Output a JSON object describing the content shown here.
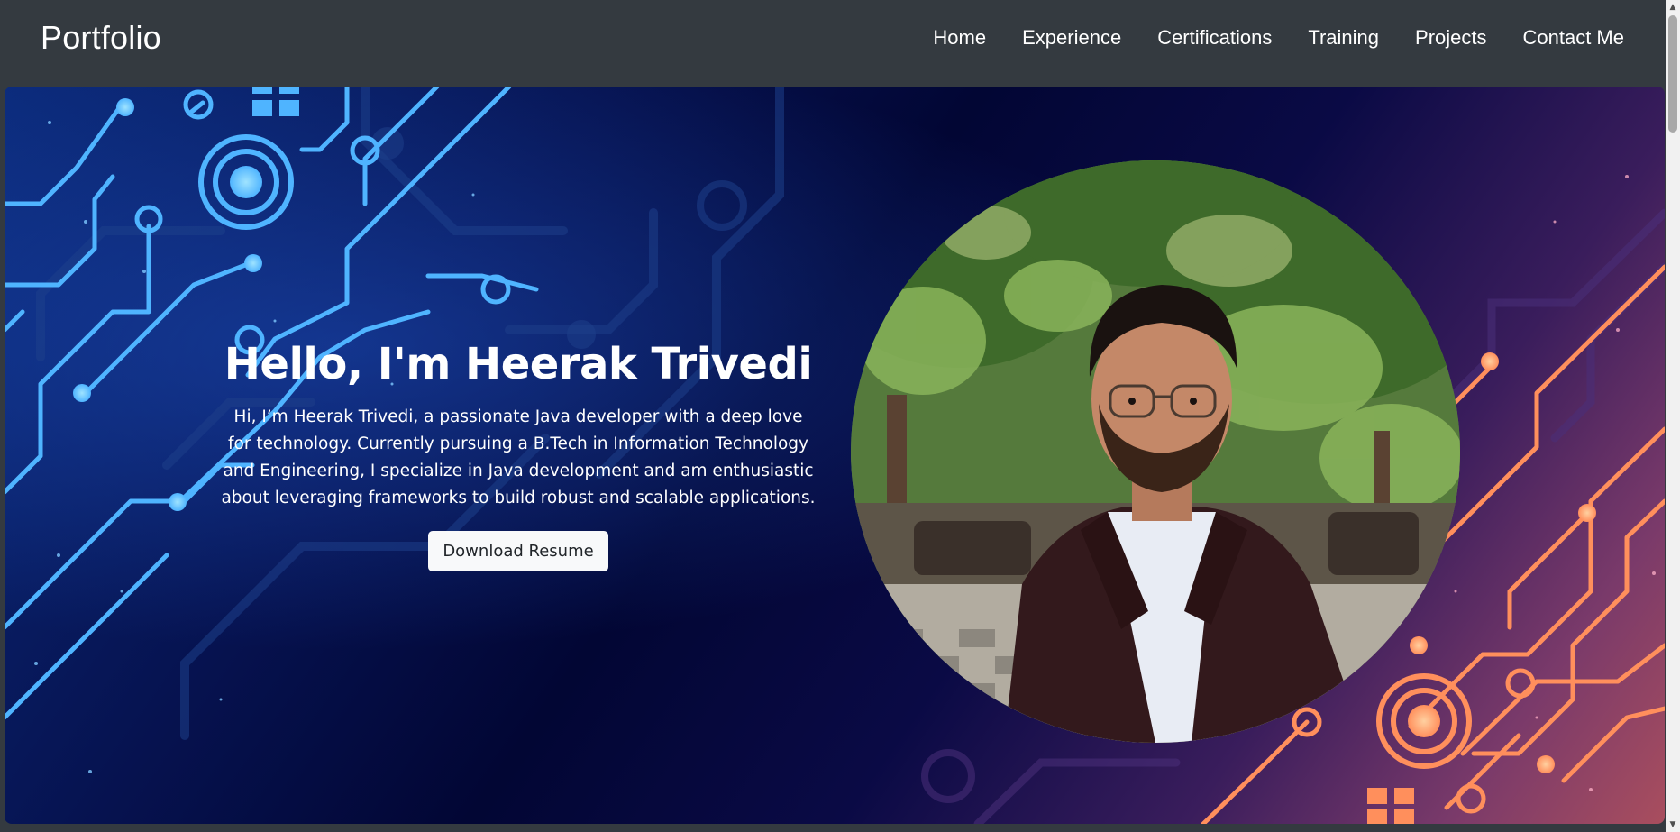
{
  "navbar": {
    "brand": "Portfolio",
    "links": [
      "Home",
      "Experience",
      "Certifications",
      "Training",
      "Projects",
      "Contact Me"
    ]
  },
  "hero": {
    "title": "Hello, I'm Heerak Trivedi",
    "description": "Hi, I’m Heerak Trivedi, a passionate Java developer with a deep love for technology. Currently pursuing a B.Tech in Information Technology and Engineering, I specialize in Java development and am enthusiastic about leveraging frameworks to build robust and scalable applications.",
    "button_label": "Download Resume"
  },
  "colors": {
    "navbar_bg": "#343a40",
    "circuit_blue": "#4fb4ff",
    "circuit_orange": "#ff8f5c",
    "hero_dark": "#020634"
  },
  "icons": {
    "scroll_up": "▲",
    "scroll_down": "▼"
  }
}
